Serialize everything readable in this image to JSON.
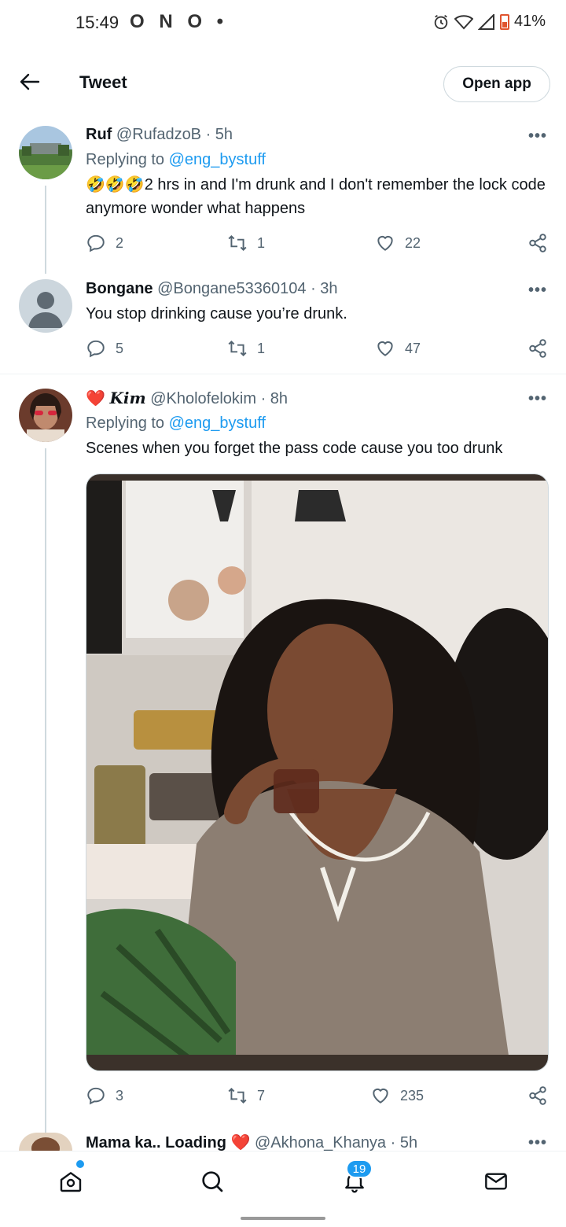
{
  "status_bar": {
    "time": "15:49",
    "notification_icons": "O N O •",
    "battery": "41%"
  },
  "header": {
    "title": "Tweet",
    "open_app_label": "Open app"
  },
  "tweets": [
    {
      "name": "Ruf",
      "handle": "@RufadzoB",
      "time": "· 5h",
      "replying_prefix": "Replying to ",
      "replying_to": "@eng_bystuff",
      "text": "🤣🤣🤣2 hrs in and I'm drunk and I don't remember the lock code anymore wonder what happens",
      "replies": "2",
      "retweets": "1",
      "likes": "22"
    },
    {
      "name": "Bongane",
      "handle": "@Bongane53360104",
      "time": "· 3h",
      "text": "You stop drinking cause you’re drunk.",
      "replies": "5",
      "retweets": "1",
      "likes": "47"
    },
    {
      "name": "Kim",
      "name_prefix_emoji": "❤️",
      "handle": "@Kholofelokim",
      "time": "· 8h",
      "replying_prefix": "Replying to ",
      "replying_to": "@eng_bystuff",
      "text": "Scenes when you forget the pass code cause you too drunk",
      "replies": "3",
      "retweets": "7",
      "likes": "235"
    },
    {
      "name": "Mama ka.. Loading",
      "name_suffix_emoji": "❤️",
      "handle": "@Akhona_Khanya",
      "time": "· 5h"
    }
  ],
  "more_label": "•••",
  "bottom_nav": {
    "notifications_badge": "19"
  },
  "colors": {
    "accent": "#1d9bf0",
    "text_primary": "#0f1419",
    "text_secondary": "#536471",
    "heart": "#e0245e"
  }
}
